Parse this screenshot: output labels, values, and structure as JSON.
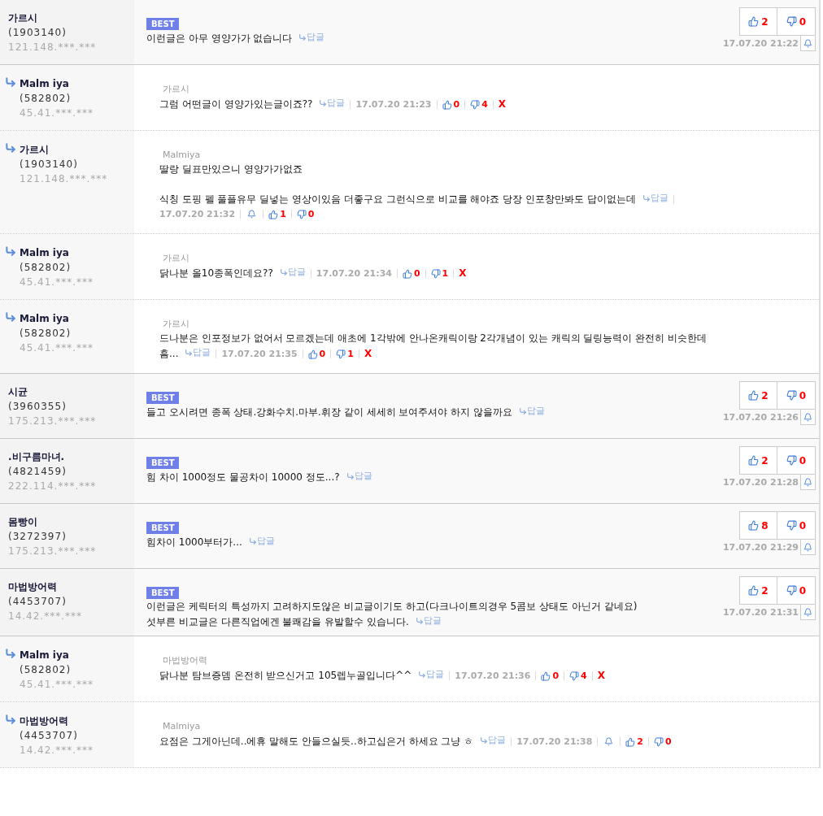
{
  "comments": [
    {
      "kind": "best",
      "author": "가르시",
      "member_id": "(1903140)",
      "ip": "121.148.***.***",
      "badge": "BEST",
      "body": "이런글은 아무 영양가가 없습니다",
      "reply_label": "답글",
      "likes": "2",
      "dislikes": "0",
      "time": "17.07.20 21:22"
    },
    {
      "kind": "reply",
      "author": "Malm iya",
      "member_id": "(582802)",
      "ip": "45.41.***.***",
      "parent": "가르시",
      "body": "그럼 어떤글이 영양가있는글이죠??",
      "reply_label": "답글",
      "time": "17.07.20 21:23",
      "likes": "0",
      "dislikes": "4",
      "delete": "X"
    },
    {
      "kind": "reply",
      "author": "가르시",
      "member_id": "(1903140)",
      "ip": "121.148.***.***",
      "parent": "Malmiya",
      "paragraphs": [
        "딸랑 딜표만있으니 영양가가없죠",
        "식칭 도핑 펠 풀플유무 딜넣는 영상이있음 더좋구요 그런식으로 비교를 해야죠 당장 인포창만봐도 답이없는데"
      ],
      "reply_label": "답글",
      "time": "17.07.20 21:32",
      "likes": "1",
      "dislikes": "0"
    },
    {
      "kind": "reply",
      "author": "Malm iya",
      "member_id": "(582802)",
      "ip": "45.41.***.***",
      "parent": "가르시",
      "body": "닭나분 올10종폭인데요??",
      "reply_label": "답글",
      "time": "17.07.20 21:34",
      "likes": "0",
      "dislikes": "1",
      "delete": "X"
    },
    {
      "kind": "reply",
      "author": "Malm iya",
      "member_id": "(582802)",
      "ip": "45.41.***.***",
      "parent": "가르시",
      "lines": [
        "드나분은 인포정보가 없어서 모르겠는데 애초에 1각밖에 안나온캐릭이랑 2각개념이 있는 캐릭의 딜링능력이 완전히 비슷한데",
        "흠..."
      ],
      "reply_label": "답글",
      "time": "17.07.20 21:35",
      "likes": "0",
      "dislikes": "1",
      "delete": "X"
    },
    {
      "kind": "best",
      "author": "시균",
      "member_id": "(3960355)",
      "ip": "175.213.***.***",
      "badge": "BEST",
      "body": "들고 오시려면 종폭 상태.강화수치.마부.휘장 같이 세세히 보여주셔야 하지 않을까요",
      "reply_label": "답글",
      "likes": "2",
      "dislikes": "0",
      "time": "17.07.20 21:26"
    },
    {
      "kind": "best",
      "author": ".비구름마녀.",
      "member_id": "(4821459)",
      "ip": "222.114.***.***",
      "badge": "BEST",
      "body": "힘 차이 1000정도 물공차이 10000 정도...?",
      "reply_label": "답글",
      "likes": "2",
      "dislikes": "0",
      "time": "17.07.20 21:28"
    },
    {
      "kind": "best",
      "author": "몸빵이",
      "member_id": "(3272397)",
      "ip": "175.213.***.***",
      "badge": "BEST",
      "body": "힘차이 1000부터가...",
      "reply_label": "답글",
      "likes": "8",
      "dislikes": "0",
      "time": "17.07.20 21:29"
    },
    {
      "kind": "best",
      "author": "마법방어력",
      "member_id": "(4453707)",
      "ip": "14.42.***.***",
      "badge": "BEST",
      "lines": [
        "이런글은 케릭터의 특성까지 고려하지도않은 비교글이기도 하고(다크나이트의경우 5콤보 상태도 아닌거 같네요)",
        "섯부른 비교글은 다른직업에겐 불쾌감을 유발할수 있습니다."
      ],
      "reply_label": "답글",
      "likes": "2",
      "dislikes": "0",
      "time": "17.07.20 21:31"
    },
    {
      "kind": "reply",
      "author": "Malm iya",
      "member_id": "(582802)",
      "ip": "45.41.***.***",
      "parent": "마법방어력",
      "body": "닭나분 탐브증뎀 온전히 받으신거고 105렙누골입니다^^",
      "reply_label": "답글",
      "time": "17.07.20 21:36",
      "likes": "0",
      "dislikes": "4",
      "delete": "X"
    },
    {
      "kind": "reply",
      "author": "마법방어력",
      "member_id": "(4453707)",
      "ip": "14.42.***.***",
      "parent": "Malmiya",
      "body": "요점은 그게아닌데..에휴 말해도 안들으실듯..하고십은거 하세요 그냥 ㅎ",
      "reply_label": "답글",
      "time": "17.07.20 21:38",
      "likes": "2",
      "dislikes": "0"
    }
  ]
}
